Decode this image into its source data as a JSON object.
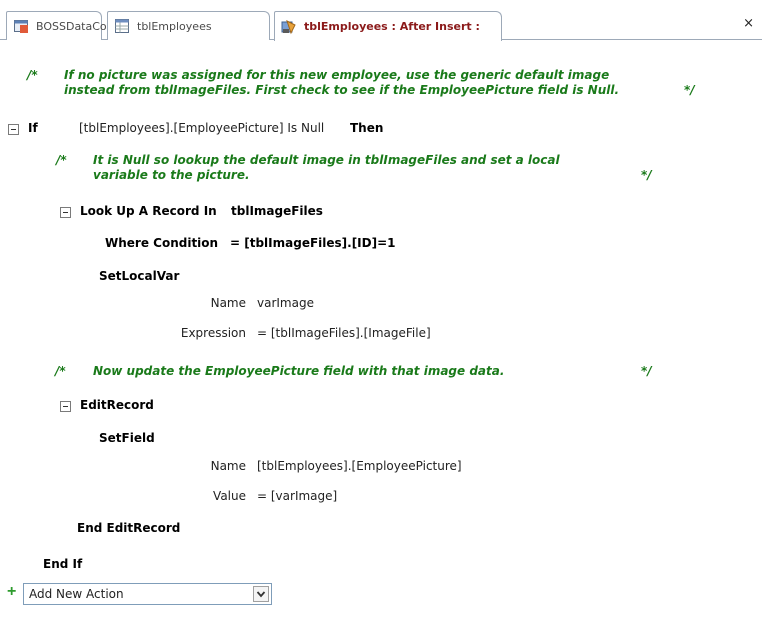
{
  "tabs": [
    {
      "label": "BOSSDataCopy",
      "icon": "database-icon"
    },
    {
      "label": "tblEmployees",
      "icon": "table-icon"
    },
    {
      "label": "tblEmployees : After Insert :",
      "icon": "macro-icon",
      "active": true
    }
  ],
  "close_symbol": "×",
  "macro": {
    "comment1": {
      "open": "/*",
      "line1": "If no picture was assigned for this new employee, use the generic default image",
      "line2": "instead from tblImageFiles. First check to see if the EmployeePicture field is Null.",
      "close": "*/"
    },
    "if_block": {
      "keyword": "If",
      "condition": "[tblEmployees].[EmployeePicture] Is Null",
      "then": "Then"
    },
    "comment2": {
      "open": "/*",
      "line1": "It is Null so lookup the default image in tblImageFiles and set a local",
      "line2": "variable to the picture.",
      "close": "*/"
    },
    "lookup": {
      "label": "Look Up A Record In",
      "table": "tblImageFiles",
      "where_label": "Where Condition",
      "where_value": "= [tblImageFiles].[ID]=1"
    },
    "setlocalvar": {
      "label": "SetLocalVar",
      "name_label": "Name",
      "name_value": "varImage",
      "expr_label": "Expression",
      "expr_value": "= [tblImageFiles].[ImageFile]"
    },
    "comment3": {
      "open": "/*",
      "text": "Now update the EmployeePicture field with that image data.",
      "close": "*/"
    },
    "editrecord": {
      "label": "EditRecord",
      "end_label": "End EditRecord"
    },
    "setfield": {
      "label": "SetField",
      "name_label": "Name",
      "name_value": "[tblEmployees].[EmployeePicture]",
      "value_label": "Value",
      "value_value": "= [varImage]"
    },
    "end_if": "End If"
  },
  "add_action": {
    "plus": "+",
    "label": "Add New Action"
  },
  "colors": {
    "comment": "#1a7a1a",
    "active_tab": "#8b1a1a",
    "plus": "#2e9b2e"
  }
}
